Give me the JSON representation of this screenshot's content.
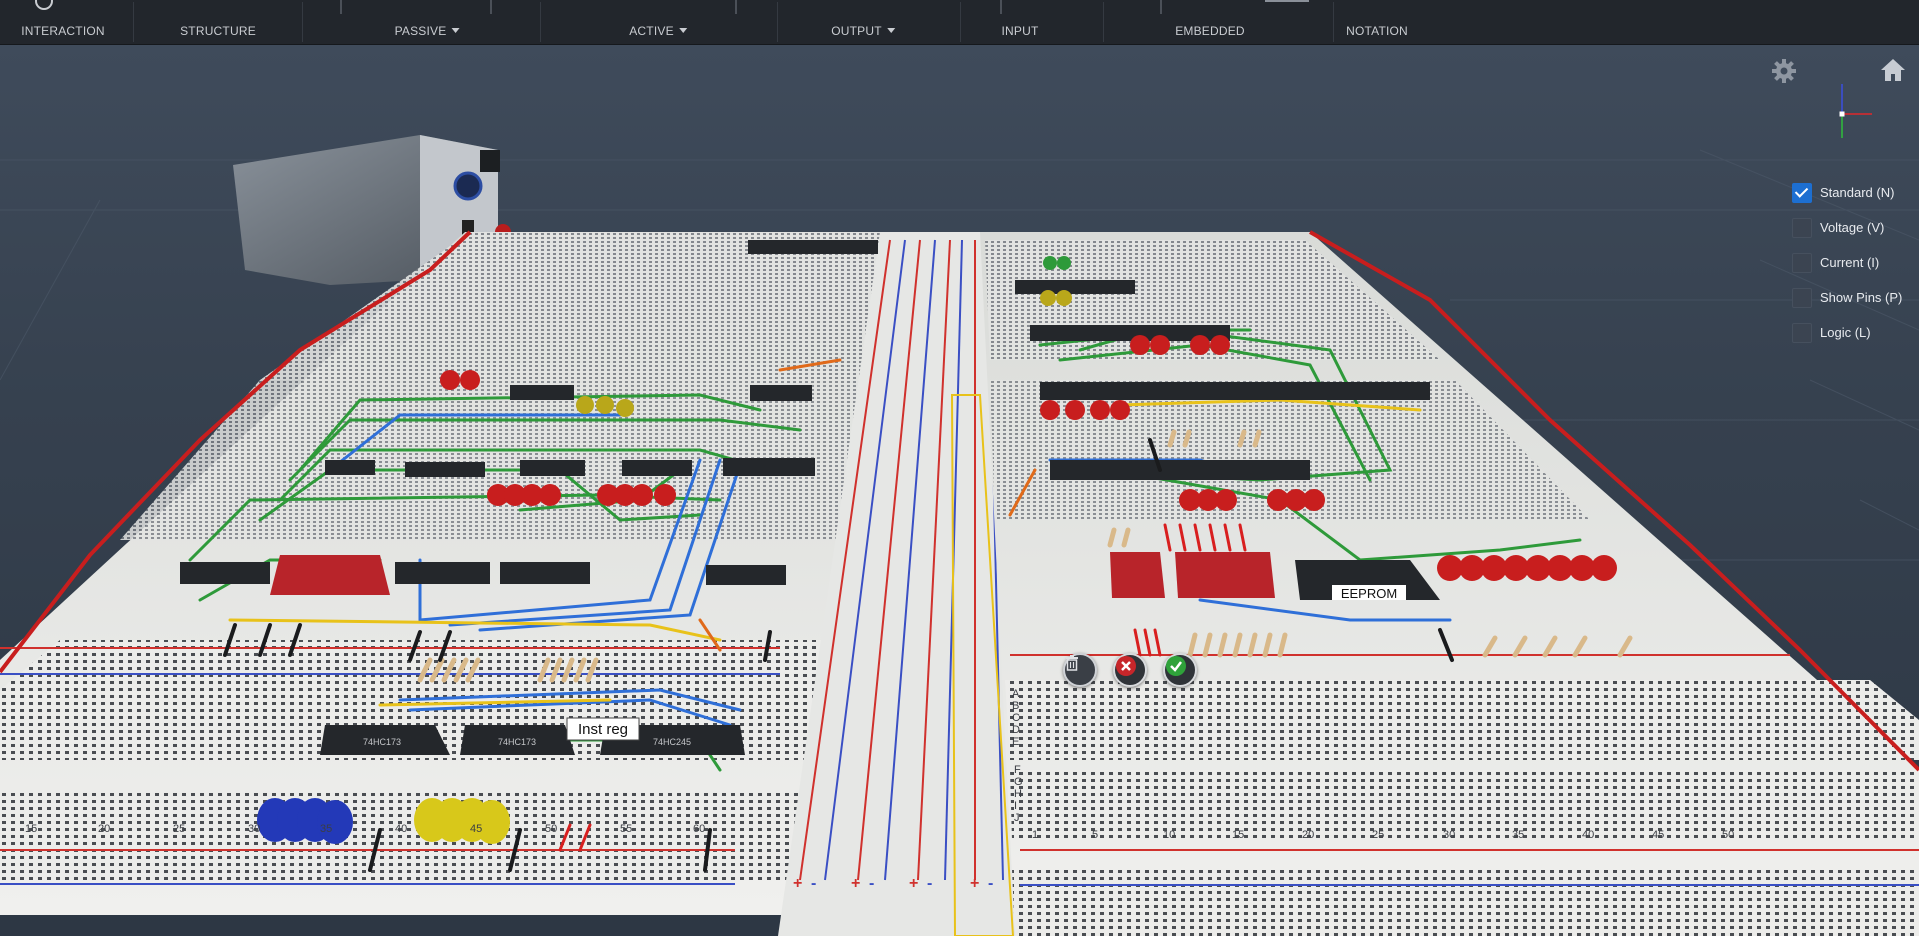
{
  "toolbar": {
    "items": [
      {
        "label": "INTERACTION",
        "dropdown": false
      },
      {
        "label": "STRUCTURE",
        "dropdown": false
      },
      {
        "label": "PASSIVE",
        "dropdown": true
      },
      {
        "label": "ACTIVE",
        "dropdown": true
      },
      {
        "label": "OUTPUT",
        "dropdown": true
      },
      {
        "label": "INPUT",
        "dropdown": false
      },
      {
        "label": "EMBEDDED",
        "dropdown": false
      },
      {
        "label": "NOTATION",
        "dropdown": false
      }
    ]
  },
  "viewport": {
    "view_options": [
      {
        "label": "Standard (N)",
        "checked": true
      },
      {
        "label": "Voltage (V)",
        "checked": false
      },
      {
        "label": "Current (I)",
        "checked": false
      },
      {
        "label": "Show Pins (P)",
        "checked": false
      },
      {
        "label": "Logic (L)",
        "checked": false
      }
    ],
    "icons": {
      "settings": "gear-icon",
      "home": "home-icon",
      "axis": "axis-gizmo-icon"
    },
    "scene_labels": {
      "inst_reg": "Inst reg",
      "eeprom": "EEPROM"
    },
    "chip_labels": [
      "74HC173",
      "74HC173",
      "74HC245"
    ],
    "row_numbers_bottom": [
      "1",
      "5",
      "10",
      "15",
      "20",
      "25",
      "30",
      "35",
      "40",
      "45",
      "50"
    ],
    "row_numbers_left": [
      "15",
      "20",
      "25",
      "30",
      "35",
      "40",
      "45",
      "50",
      "55",
      "60"
    ],
    "row_letters": [
      "A",
      "B",
      "C",
      "D",
      "E",
      "F",
      "G",
      "H",
      "I",
      "J"
    ],
    "rail_signs": [
      "+",
      "-",
      "+",
      "-",
      "+",
      "-",
      "+",
      "-"
    ],
    "actions": [
      {
        "name": "delete",
        "icon": "trash-icon"
      },
      {
        "name": "cancel",
        "icon": "close-icon"
      },
      {
        "name": "confirm",
        "icon": "check-icon"
      }
    ],
    "colors": {
      "accent_blue": "#1d6fd1",
      "wire_green": "#2e9a3a",
      "wire_blue": "#2f6fd8",
      "led_red": "#c81e1e",
      "led_yellow": "#d8c81a",
      "rail_red": "#d0312d",
      "rail_blue": "#3a4fc4",
      "board_white": "#e9e9e6"
    }
  }
}
